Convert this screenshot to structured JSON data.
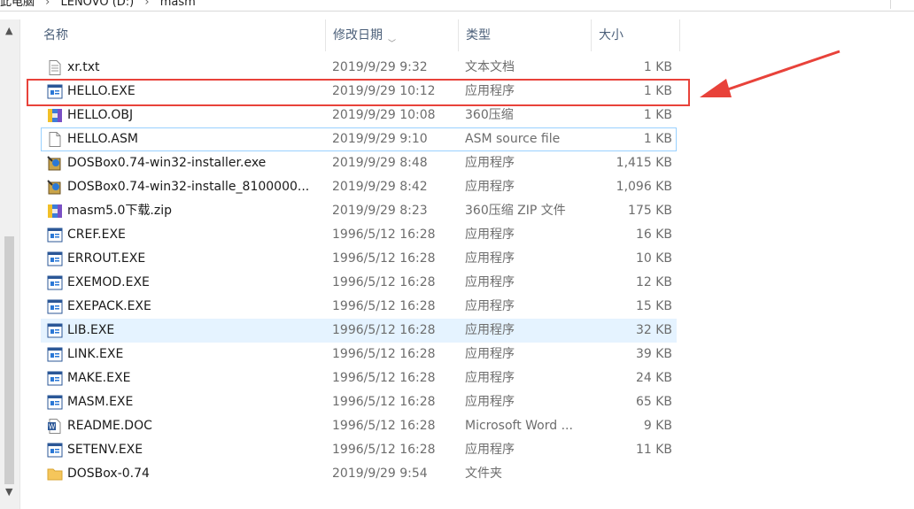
{
  "address": {
    "crumbs": [
      "此电脑",
      "LENOVO (D:)",
      "masm"
    ],
    "separator": "›"
  },
  "columns": {
    "name": "名称",
    "date": "修改日期",
    "type": "类型",
    "size": "大小",
    "sorted_by": "date",
    "sort_icon": "chevron-down-icon"
  },
  "files": [
    {
      "name": "xr.txt",
      "date": "2019/9/29 9:32",
      "type": "文本文档",
      "size": "1 KB",
      "icon": "text-file-icon"
    },
    {
      "name": "HELLO.EXE",
      "date": "2019/9/29 10:12",
      "type": "应用程序",
      "size": "1 KB",
      "icon": "exe-icon"
    },
    {
      "name": "HELLO.OBJ",
      "date": "2019/9/29 10:08",
      "type": "360压缩",
      "size": "1 KB",
      "icon": "archive-icon"
    },
    {
      "name": "HELLO.ASM",
      "date": "2019/9/29 9:10",
      "type": "ASM source file",
      "size": "1 KB",
      "icon": "blank-file-icon"
    },
    {
      "name": "DOSBox0.74-win32-installer.exe",
      "date": "2019/9/29 8:48",
      "type": "应用程序",
      "size": "1,415 KB",
      "icon": "installer-icon"
    },
    {
      "name": "DOSBox0.74-win32-installe_8100000...",
      "date": "2019/9/29 8:42",
      "type": "应用程序",
      "size": "1,096 KB",
      "icon": "installer-icon"
    },
    {
      "name": "masm5.0下载.zip",
      "date": "2019/9/29 8:23",
      "type": "360压缩 ZIP 文件",
      "size": "175 KB",
      "icon": "archive-icon"
    },
    {
      "name": "CREF.EXE",
      "date": "1996/5/12 16:28",
      "type": "应用程序",
      "size": "16 KB",
      "icon": "exe-icon"
    },
    {
      "name": "ERROUT.EXE",
      "date": "1996/5/12 16:28",
      "type": "应用程序",
      "size": "10 KB",
      "icon": "exe-icon"
    },
    {
      "name": "EXEMOD.EXE",
      "date": "1996/5/12 16:28",
      "type": "应用程序",
      "size": "12 KB",
      "icon": "exe-icon"
    },
    {
      "name": "EXEPACK.EXE",
      "date": "1996/5/12 16:28",
      "type": "应用程序",
      "size": "15 KB",
      "icon": "exe-icon"
    },
    {
      "name": "LIB.EXE",
      "date": "1996/5/12 16:28",
      "type": "应用程序",
      "size": "32 KB",
      "icon": "exe-icon"
    },
    {
      "name": "LINK.EXE",
      "date": "1996/5/12 16:28",
      "type": "应用程序",
      "size": "39 KB",
      "icon": "exe-icon"
    },
    {
      "name": "MAKE.EXE",
      "date": "1996/5/12 16:28",
      "type": "应用程序",
      "size": "24 KB",
      "icon": "exe-icon"
    },
    {
      "name": "MASM.EXE",
      "date": "1996/5/12 16:28",
      "type": "应用程序",
      "size": "65 KB",
      "icon": "exe-icon"
    },
    {
      "name": "README.DOC",
      "date": "1996/5/12 16:28",
      "type": "Microsoft Word ...",
      "size": "9 KB",
      "icon": "word-doc-icon"
    },
    {
      "name": "SETENV.EXE",
      "date": "1996/5/12 16:28",
      "type": "应用程序",
      "size": "11 KB",
      "icon": "exe-icon"
    },
    {
      "name": "DOSBox-0.74",
      "date": "2019/9/29 9:54",
      "type": "文件夹",
      "size": "",
      "icon": "folder-icon"
    }
  ],
  "state": {
    "focused_item": "HELLO.ASM",
    "hovered_item": "LIB.EXE",
    "annotated_item": "HELLO.EXE"
  },
  "colors": {
    "annotation_red": "#e8423a",
    "hover_bg": "#e5f3ff",
    "focus_border": "#99d1ff",
    "header_text": "#4c607a"
  }
}
